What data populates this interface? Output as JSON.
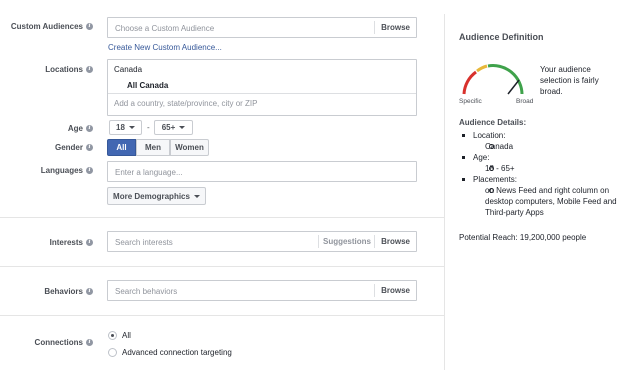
{
  "custom_audiences": {
    "label": "Custom Audiences",
    "placeholder": "Choose a Custom Audience",
    "browse": "Browse",
    "create_link": "Create New Custom Audience..."
  },
  "locations": {
    "label": "Locations",
    "country": "Canada",
    "selected": "All Canada",
    "placeholder": "Add a country, state/province, city or ZIP"
  },
  "age": {
    "label": "Age",
    "min": "18",
    "separator": "-",
    "max": "65+"
  },
  "gender": {
    "label": "Gender",
    "options": [
      "All",
      "Men",
      "Women"
    ],
    "selected": "All"
  },
  "languages": {
    "label": "Languages",
    "placeholder": "Enter a language..."
  },
  "more_demographics": "More Demographics",
  "interests": {
    "label": "Interests",
    "placeholder": "Search interests",
    "suggestions": "Suggestions",
    "browse": "Browse"
  },
  "behaviors": {
    "label": "Behaviors",
    "placeholder": "Search behaviors",
    "browse": "Browse"
  },
  "connections": {
    "label": "Connections",
    "options": [
      "All",
      "Advanced connection targeting"
    ],
    "selected": "All"
  },
  "audience_definition": {
    "title": "Audience Definition",
    "gauge_text": "Your audience selection is fairly broad.",
    "gauge_left": "Specific",
    "gauge_right": "Broad",
    "details_title": "Audience Details:",
    "location_label": "Location:",
    "location_value": "Canada",
    "age_label": "Age:",
    "age_value": "18 - 65+",
    "placements_label": "Placements:",
    "placements_value": "on News Feed and right column on desktop computers, Mobile Feed and Third-party Apps",
    "potential_reach": "Potential Reach: 19,200,000 people"
  },
  "colors": {
    "accent": "#4267b2",
    "link": "#365899",
    "gauge_red": "#d8312c",
    "gauge_yellow": "#e8b83a",
    "gauge_green": "#3fa24b"
  },
  "icons": [
    "info-icon",
    "caret-down-icon",
    "radio-icon",
    "gauge-icon"
  ]
}
